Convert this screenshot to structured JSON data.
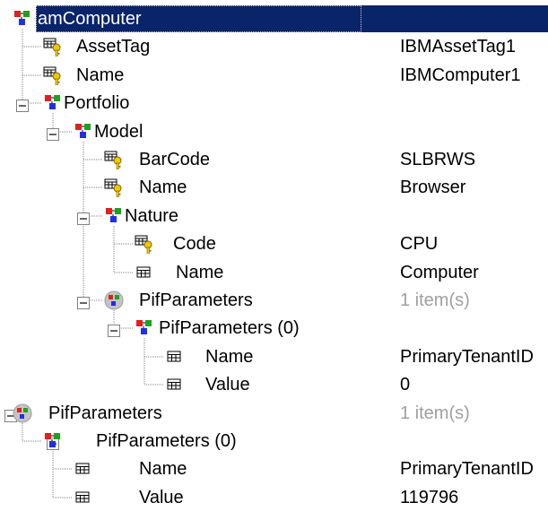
{
  "tree": {
    "nodes": [
      {
        "label": "amComputer",
        "value": "",
        "type": "object",
        "selected": true
      },
      {
        "label": "AssetTag",
        "value": "IBMAssetTag1",
        "type": "key-field"
      },
      {
        "label": "Name",
        "value": "IBMComputer1",
        "type": "key-field"
      },
      {
        "label": "Portfolio",
        "value": "",
        "type": "object",
        "toggle": "minus"
      },
      {
        "label": "Model",
        "value": "",
        "type": "object",
        "toggle": "minus"
      },
      {
        "label": "BarCode",
        "value": "SLBRWS",
        "type": "key-field"
      },
      {
        "label": "Name",
        "value": "Browser",
        "type": "key-field"
      },
      {
        "label": "Nature",
        "value": "",
        "type": "object",
        "toggle": "minus"
      },
      {
        "label": "Code",
        "value": "CPU",
        "type": "key-field"
      },
      {
        "label": "Name",
        "value": "Computer",
        "type": "field"
      },
      {
        "label": "PifParameters",
        "value": "1 item(s)",
        "type": "collection",
        "toggle": "minus",
        "valueMuted": true
      },
      {
        "label": "PifParameters (0)",
        "value": "",
        "type": "object",
        "toggle": "minus"
      },
      {
        "label": "Name",
        "value": "PrimaryTenantID",
        "type": "field"
      },
      {
        "label": "Value",
        "value": "0",
        "type": "field"
      },
      {
        "label": "PifParameters",
        "value": "1 item(s)",
        "type": "collection",
        "toggle": "minus",
        "valueMuted": true
      },
      {
        "label": "PifParameters (0)",
        "value": "",
        "type": "object",
        "toggle": "minus"
      },
      {
        "label": "Name",
        "value": "PrimaryTenantID",
        "type": "field"
      },
      {
        "label": "Value",
        "value": "119796",
        "type": "field"
      }
    ]
  },
  "icons": {
    "object": "object-node-icon",
    "key-field": "key-field-icon",
    "field": "field-icon",
    "collection": "collection-icon",
    "toggle": "expand-toggle-icon"
  },
  "colors": {
    "selection": "#0a246a",
    "muted_value": "#a0a0a0",
    "tree_lines": "#808080"
  }
}
